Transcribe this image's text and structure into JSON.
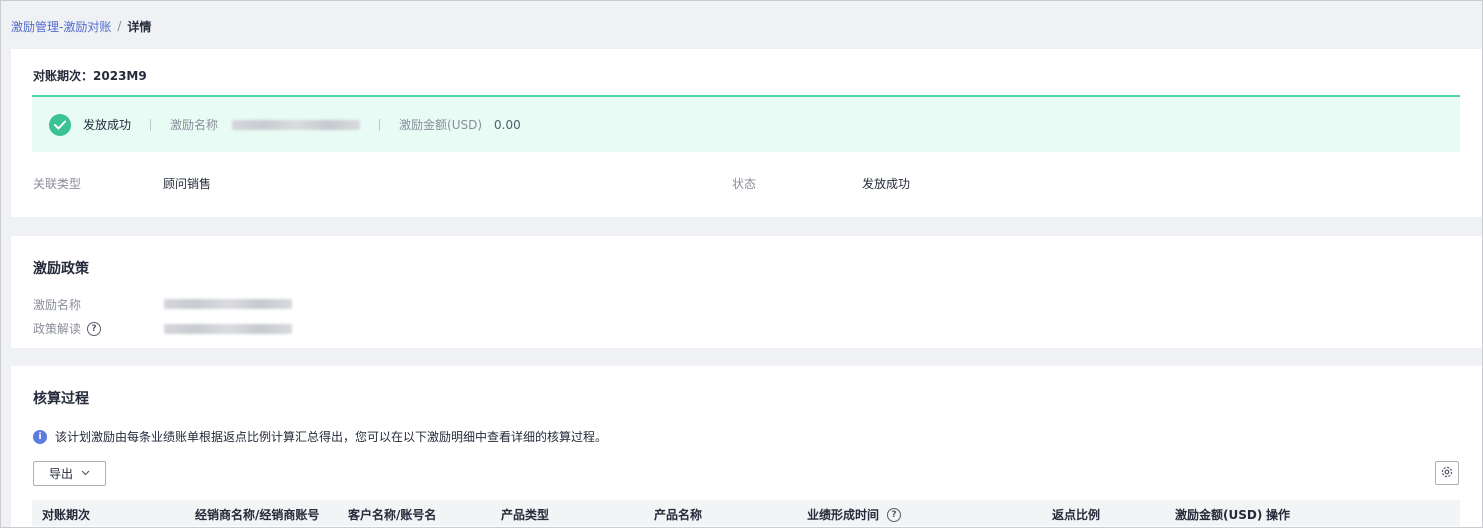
{
  "breadcrumb": {
    "parent": "激励管理-激励对账",
    "separator": "/",
    "current": "详情"
  },
  "summary": {
    "period_label": "对账期次：",
    "period_value": "2023M9",
    "status_text": "发放成功",
    "incentive_name_label": "激励名称",
    "amount_label": "激励金额(USD)",
    "amount_value": "0.00",
    "related_type_label": "关联类型",
    "related_type_value": "顾问销售",
    "state_label": "状态",
    "state_value": "发放成功"
  },
  "policy": {
    "title": "激励政策",
    "name_label": "激励名称",
    "interpretation_label": "政策解读"
  },
  "process": {
    "title": "核算过程",
    "notice": "该计划激励由每条业绩账单根据返点比例计算汇总得出，您可以在以下激励明细中查看详细的核算过程。",
    "export_label": "导出",
    "columns": [
      "对账期次",
      "经销商名称/经销商账号",
      "客户名称/账号名",
      "产品类型",
      "产品名称",
      "业绩形成时间",
      "返点比例",
      "激励金额(USD)",
      "操作"
    ]
  },
  "colors": {
    "link": "#526ecc",
    "success": "#3ac295",
    "banner_bg": "#e8fbf5",
    "info": "#5e7ce0"
  }
}
